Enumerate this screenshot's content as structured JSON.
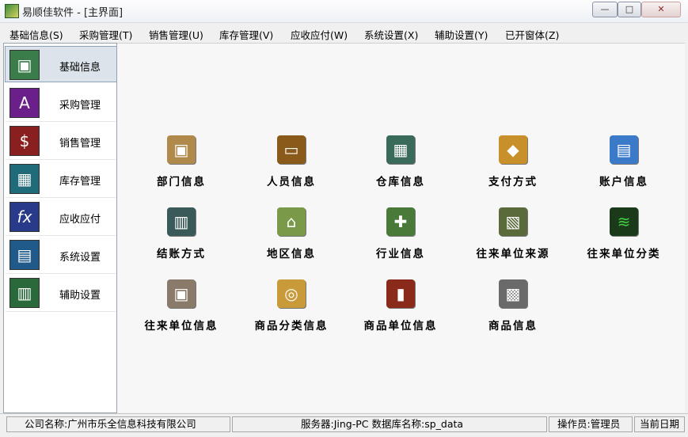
{
  "window": {
    "title": "易顺佳软件 - [主界面]",
    "min_icon": "minimize-icon",
    "max_icon": "maximize-icon",
    "close_icon": "close-icon",
    "min_glyph": "—",
    "max_glyph": "□",
    "close_glyph": "✕"
  },
  "menu": [
    "基础信息(S)",
    "采购管理(T)",
    "销售管理(U)",
    "库存管理(V)",
    "应收应付(W)",
    "系统设置(X)",
    "辅助设置(Y)",
    "已开窗体(Z)"
  ],
  "sidebar": {
    "items": [
      {
        "label": "基础信息",
        "icon": "basic-info-icon",
        "glyph": "▣",
        "color": "#3a7c4a"
      },
      {
        "label": "采购管理",
        "icon": "purchase-icon",
        "glyph": "A",
        "color": "#6b1f8a"
      },
      {
        "label": "销售管理",
        "icon": "sales-icon",
        "glyph": "$",
        "color": "#8a1f1f"
      },
      {
        "label": "库存管理",
        "icon": "inventory-icon",
        "glyph": "▦",
        "color": "#1f6b7a"
      },
      {
        "label": "应收应付",
        "icon": "receivable-payable-icon",
        "glyph": "fx",
        "color": "#2a3a8a"
      },
      {
        "label": "系统设置",
        "icon": "system-settings-icon",
        "glyph": "▤",
        "color": "#1f5a8a"
      },
      {
        "label": "辅助设置",
        "icon": "auxiliary-settings-icon",
        "glyph": "▥",
        "color": "#2a6a3a"
      }
    ]
  },
  "tiles": [
    {
      "label": "部门信息",
      "icon": "department-icon",
      "glyph": "▣",
      "color": "#b08a4a"
    },
    {
      "label": "人员信息",
      "icon": "personnel-icon",
      "glyph": "▭",
      "color": "#8a5a1a"
    },
    {
      "label": "仓库信息",
      "icon": "warehouse-icon",
      "glyph": "▦",
      "color": "#3a6a5a"
    },
    {
      "label": "支付方式",
      "icon": "payment-method-icon",
      "glyph": "◆",
      "color": "#c8902a"
    },
    {
      "label": "账户信息",
      "icon": "account-icon",
      "glyph": "▤",
      "color": "#3a7ac8"
    },
    {
      "label": "结账方式",
      "icon": "settlement-method-icon",
      "glyph": "▥",
      "color": "#3a5a5a"
    },
    {
      "label": "地区信息",
      "icon": "region-icon",
      "glyph": "⌂",
      "color": "#7a9a4a"
    },
    {
      "label": "行业信息",
      "icon": "industry-icon",
      "glyph": "✚",
      "color": "#4a7a3a"
    },
    {
      "label": "往来单位来源",
      "icon": "partner-source-icon",
      "glyph": "▧",
      "color": "#5a6a3a"
    },
    {
      "label": "往来单位分类",
      "icon": "partner-category-icon",
      "glyph": "≋",
      "color": "#1a3a1a"
    },
    {
      "label": "往来单位信息",
      "icon": "partner-info-icon",
      "glyph": "▣",
      "color": "#8a7a6a"
    },
    {
      "label": "商品分类信息",
      "icon": "product-category-icon",
      "glyph": "◎",
      "color": "#c89a3a"
    },
    {
      "label": "商品单位信息",
      "icon": "product-unit-icon",
      "glyph": "▮",
      "color": "#8a2a1a"
    },
    {
      "label": "商品信息",
      "icon": "product-info-icon",
      "glyph": "▩",
      "color": "#6a6a6a"
    }
  ],
  "status": {
    "company": "公司名称:广州市乐全信息科技有限公司",
    "server": "服务器:Jing-PC  数据库名称:sp_data",
    "operator": "操作员:管理员",
    "date": "当前日期"
  }
}
